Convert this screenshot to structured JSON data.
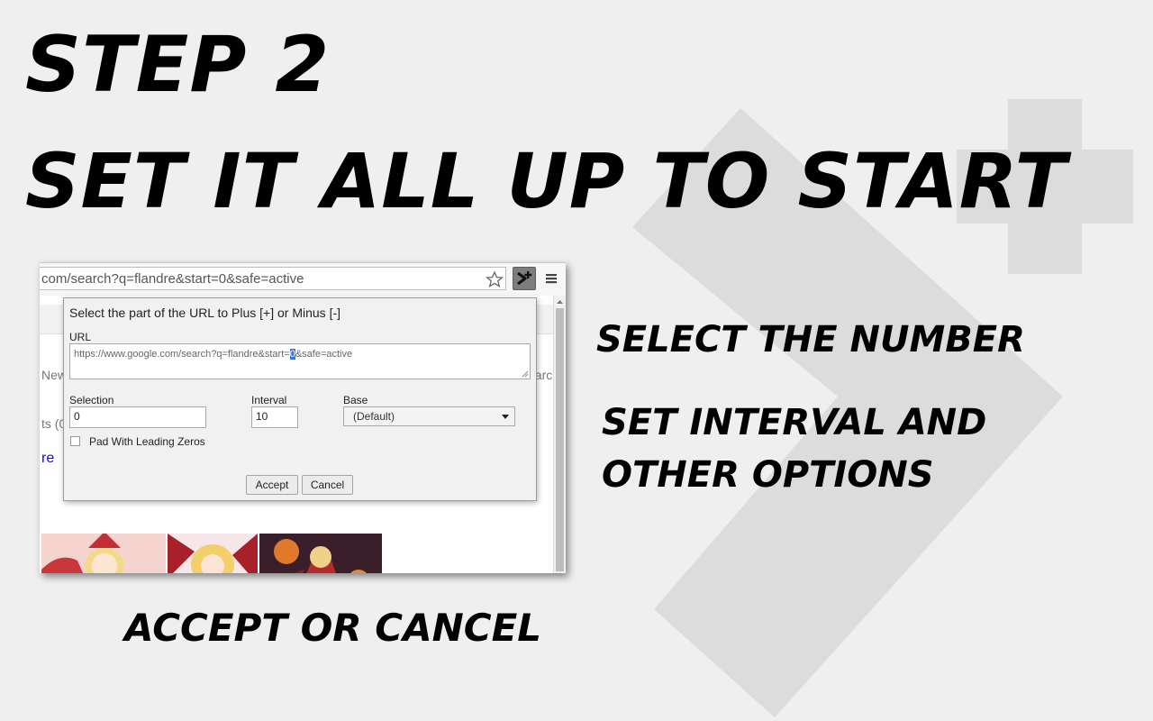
{
  "headline": {
    "step": "STEP 2",
    "title": "SET IT ALL UP TO START"
  },
  "captions": {
    "select_number": "SELECT THE NUMBER",
    "interval_line1": "SET INTERVAL AND",
    "interval_line2": "OTHER OPTIONS",
    "accept_cancel": "ACCEPT OR CANCEL"
  },
  "browser": {
    "address": "com/search?q=flandre&start=0&safe=active",
    "page_fragments": {
      "new": "New",
      "results": "ts (0",
      "link": "re",
      "search": "earc"
    }
  },
  "dialog": {
    "title": "Select the part of the URL to Plus [+] or Minus [-]",
    "url_label": "URL",
    "url_before": "https://www.google.com/search?q=flandre&start=",
    "url_selected": "0",
    "url_after": "&safe=active",
    "selection_label": "Selection",
    "selection_value": "0",
    "interval_label": "Interval",
    "interval_value": "10",
    "base_label": "Base",
    "base_value": "(Default)",
    "pad_label": "Pad With Leading Zeros",
    "accept_label": "Accept",
    "cancel_label": "Cancel"
  },
  "colors": {
    "background": "#efefef",
    "decor": "#dcdcdc",
    "selection_highlight": "#3875d7"
  },
  "icons": [
    "star-icon",
    "extension-plus-minus-icon",
    "menu-icon",
    "chevron-down-icon"
  ]
}
